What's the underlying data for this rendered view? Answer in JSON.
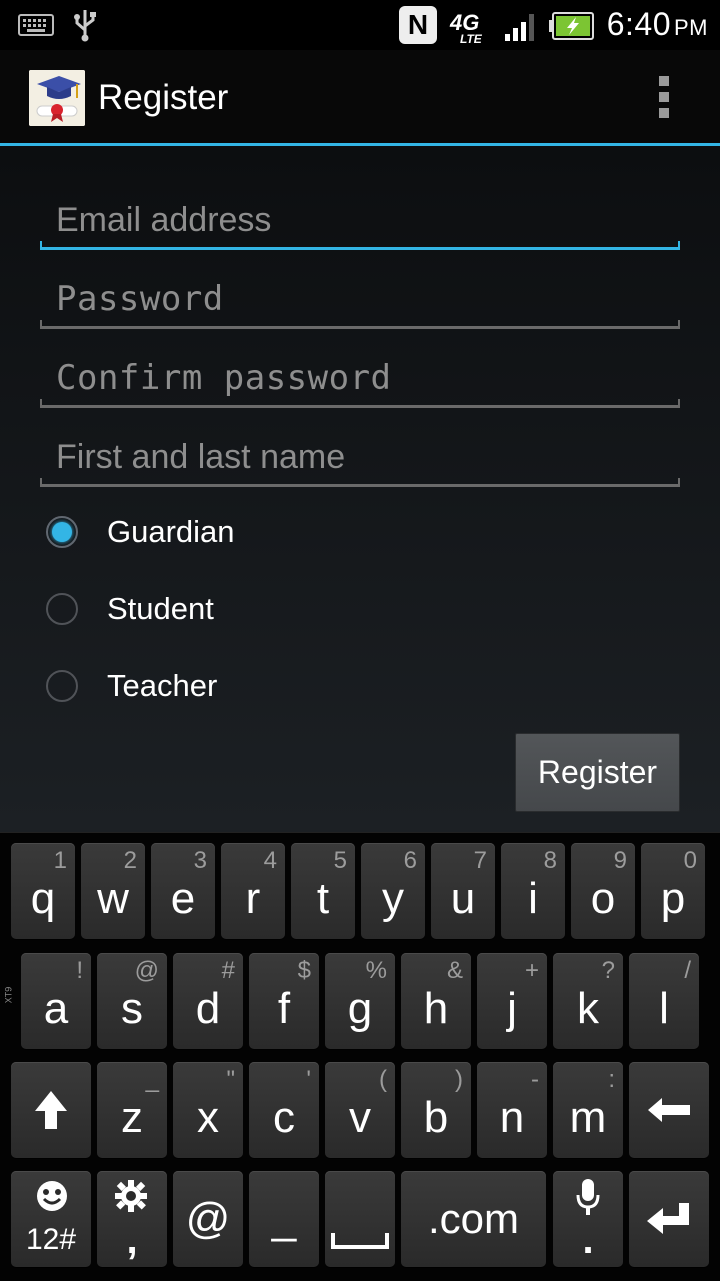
{
  "status_bar": {
    "time": "6:40",
    "ampm": "PM",
    "icons": [
      "keyboard-icon",
      "usb-icon",
      "nfc-icon",
      "4g-lte-icon",
      "signal-icon",
      "battery-charging-icon"
    ],
    "network_label": "4G",
    "network_sub": "LTE",
    "nfc_letter": "N"
  },
  "action_bar": {
    "title": "Register",
    "overflow_icon": "overflow-menu-icon"
  },
  "form": {
    "email_placeholder": "Email address",
    "password_placeholder": "Password",
    "confirm_password_placeholder": "Confirm password",
    "name_placeholder": "First and last name",
    "roles": [
      {
        "label": "Guardian",
        "checked": true
      },
      {
        "label": "Student",
        "checked": false
      },
      {
        "label": "Teacher",
        "checked": false
      }
    ],
    "submit_label": "Register"
  },
  "keyboard": {
    "side_label": "XT9",
    "row1": [
      {
        "key": "q",
        "hint": "1"
      },
      {
        "key": "w",
        "hint": "2"
      },
      {
        "key": "e",
        "hint": "3"
      },
      {
        "key": "r",
        "hint": "4"
      },
      {
        "key": "t",
        "hint": "5"
      },
      {
        "key": "y",
        "hint": "6"
      },
      {
        "key": "u",
        "hint": "7"
      },
      {
        "key": "i",
        "hint": "8"
      },
      {
        "key": "o",
        "hint": "9"
      },
      {
        "key": "p",
        "hint": "0"
      }
    ],
    "row2": [
      {
        "key": "a",
        "hint": "!"
      },
      {
        "key": "s",
        "hint": "@"
      },
      {
        "key": "d",
        "hint": "#"
      },
      {
        "key": "f",
        "hint": "$"
      },
      {
        "key": "g",
        "hint": "%"
      },
      {
        "key": "h",
        "hint": "&"
      },
      {
        "key": "j",
        "hint": "+"
      },
      {
        "key": "k",
        "hint": "?"
      },
      {
        "key": "l",
        "hint": "/"
      }
    ],
    "row3": [
      {
        "key": "z",
        "hint": "_"
      },
      {
        "key": "x",
        "hint": "\""
      },
      {
        "key": "c",
        "hint": "'"
      },
      {
        "key": "v",
        "hint": "("
      },
      {
        "key": "b",
        "hint": ")"
      },
      {
        "key": "n",
        "hint": "-"
      },
      {
        "key": "m",
        "hint": ":"
      }
    ],
    "symbols_label": "12#",
    "comma_label": ",",
    "at_label": "@",
    "underscore_label": "_",
    "dotcom_label": ".com",
    "period_label": "."
  },
  "colors": {
    "accent": "#33b5e5",
    "background": "#000000"
  }
}
